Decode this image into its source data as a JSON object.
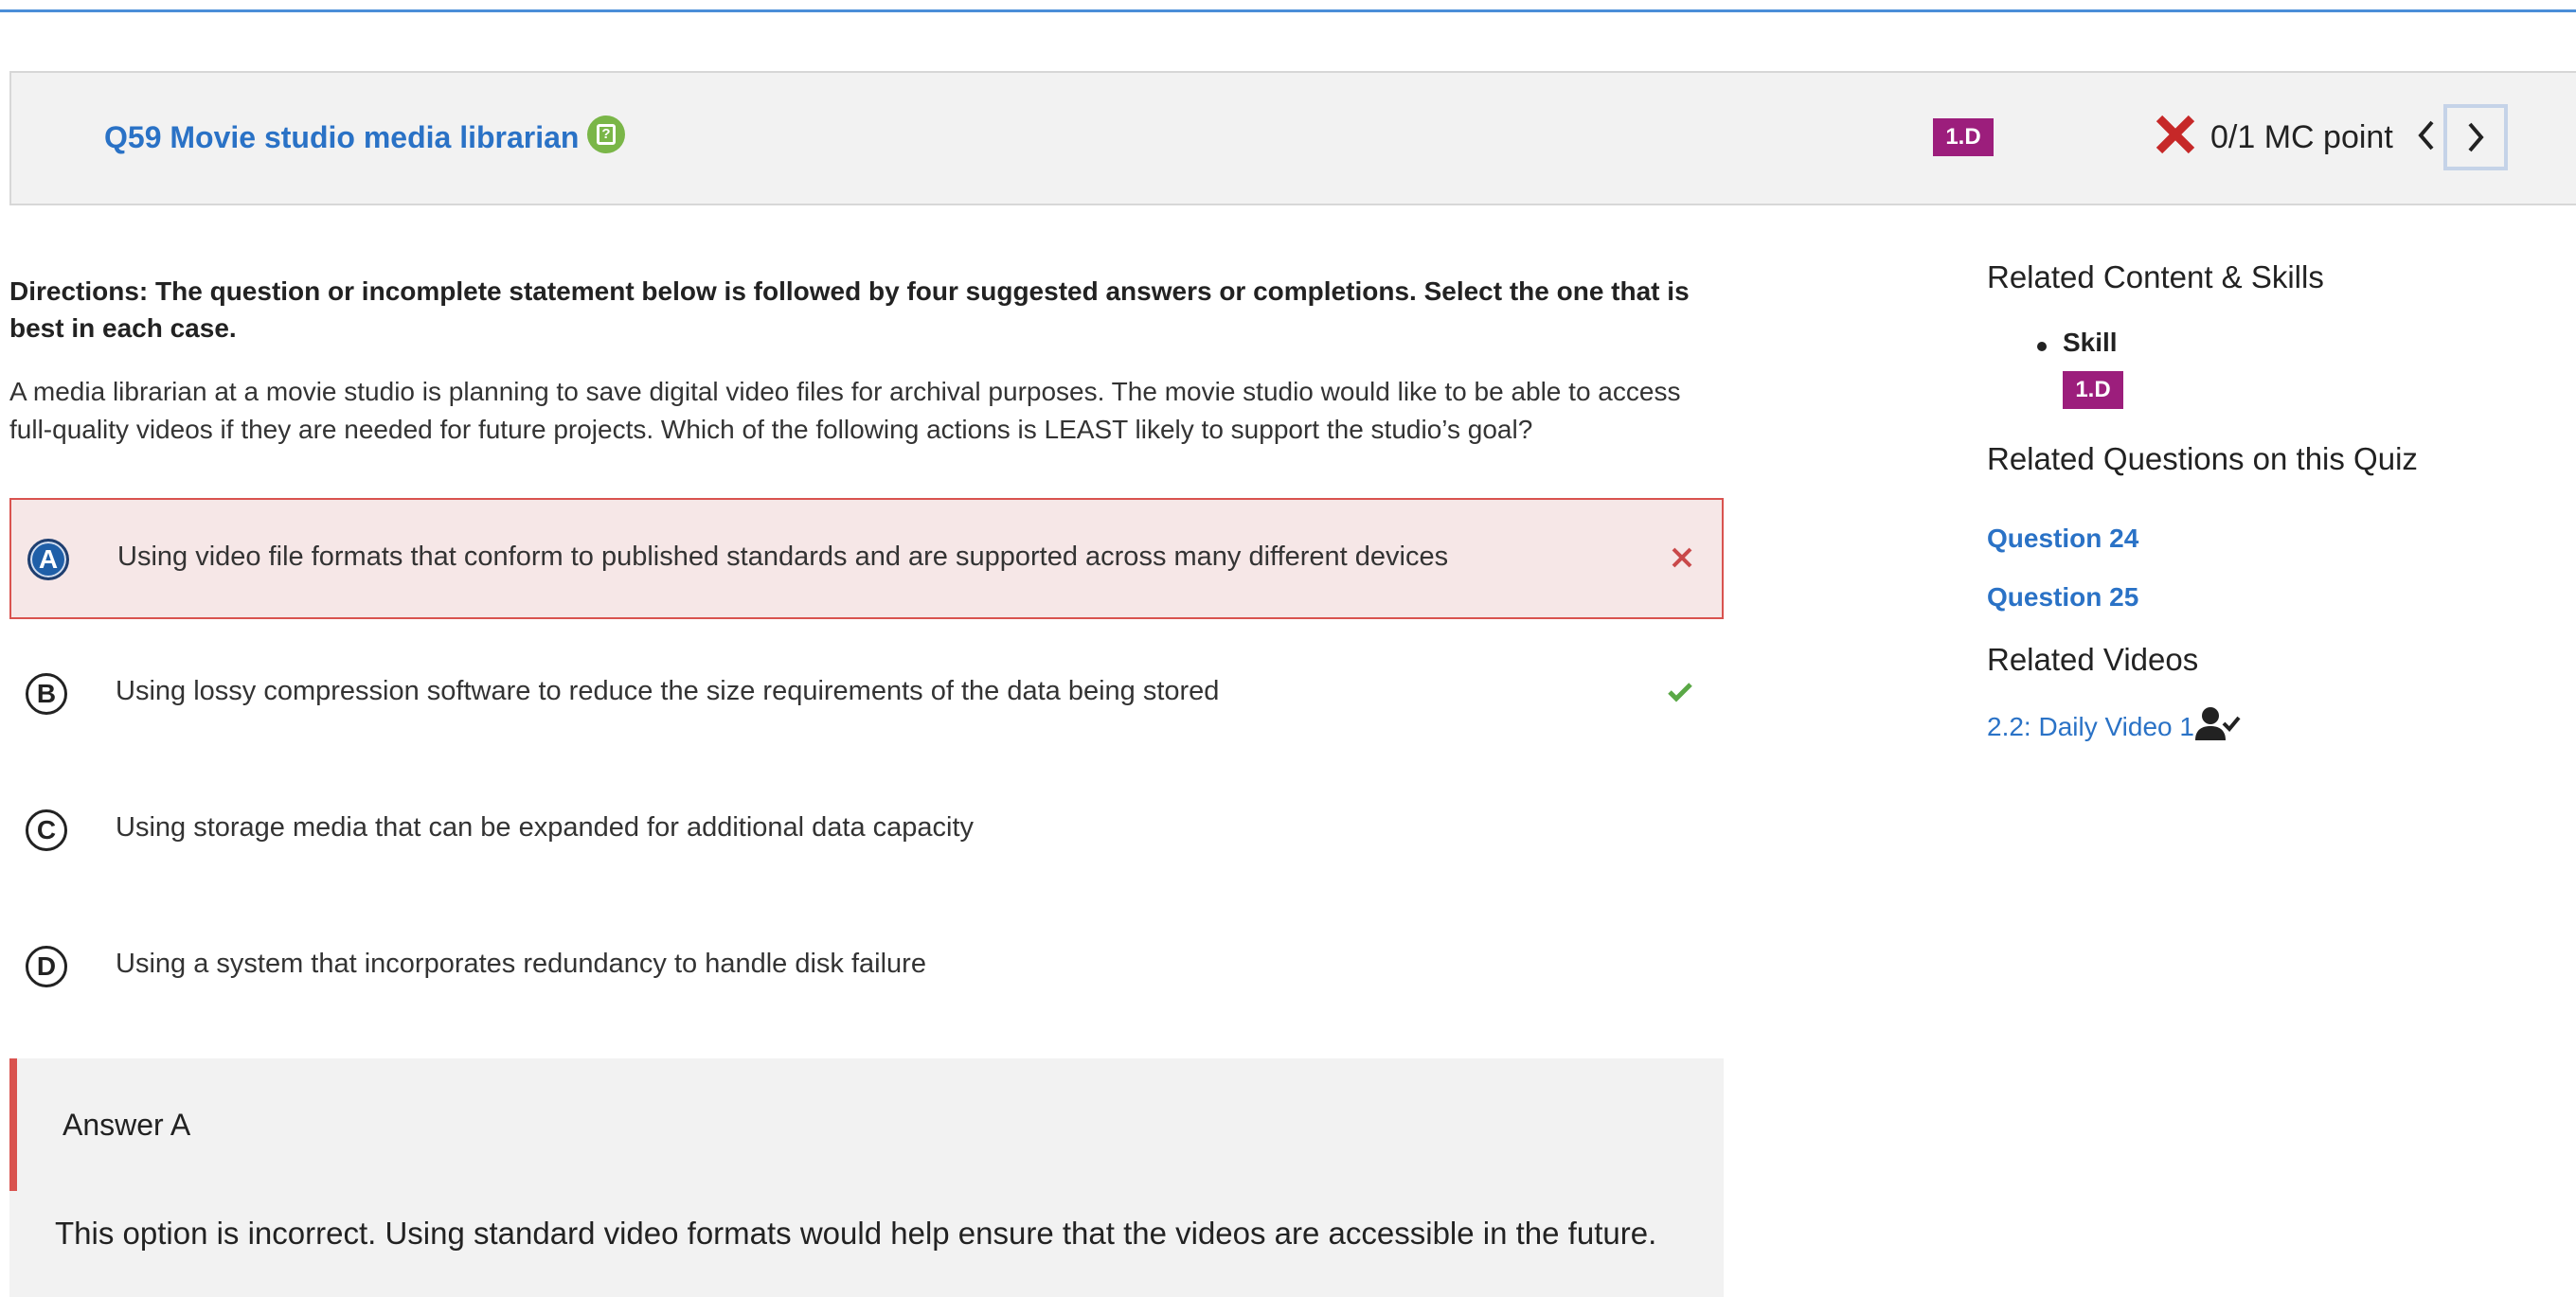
{
  "header": {
    "title": "Q59 Movie studio media librarian",
    "question_icon": "question-clipboard-icon",
    "skill_badge": "1.D",
    "score_status_icon": "red-x-icon",
    "score": "0/1 MC point",
    "prev_icon": "chevron-left-icon",
    "next_icon": "chevron-right-icon"
  },
  "question": {
    "directions": "Directions: The question or incomplete statement below is followed by four suggested answers or completions. Select the one that is best in each case.",
    "stem": "A media librarian at a movie studio is planning to save digital video files for archival purposes. The movie studio would like to be able to access full-quality videos if they are needed for future projects. Which of the following actions is LEAST likely to support the studio’s goal?",
    "choices": [
      {
        "letter": "A",
        "text": "Using video file formats that conform to published standards and are supported across many different devices",
        "selected": true,
        "status": "incorrect"
      },
      {
        "letter": "B",
        "text": "Using lossy compression software to reduce the size requirements of the data being stored",
        "selected": false,
        "status": "correct"
      },
      {
        "letter": "C",
        "text": "Using storage media that can be expanded for additional data capacity",
        "selected": false,
        "status": "none"
      },
      {
        "letter": "D",
        "text": "Using a system that incorporates redundancy to handle disk failure",
        "selected": false,
        "status": "none"
      }
    ]
  },
  "feedback": {
    "heading": "Answer A",
    "body": "This option is incorrect. Using standard video formats would help ensure that the videos are accessible in the future."
  },
  "sidebar": {
    "related_content_heading": "Related Content & Skills",
    "skill_label": "Skill",
    "skill_badge": "1.D",
    "related_questions_heading": "Related Questions on this Quiz",
    "related_questions": [
      "Question 24",
      "Question 25"
    ],
    "related_videos_heading": "Related Videos",
    "video_link": "2.2: Daily Video 1",
    "video_icon": "person-check-icon"
  },
  "colors": {
    "accent_blue": "#2a72c6",
    "skill_badge": "#9c1e7c",
    "incorrect_red": "#d9534f",
    "correct_green": "#5aa846",
    "question_icon_green": "#7ab648"
  }
}
